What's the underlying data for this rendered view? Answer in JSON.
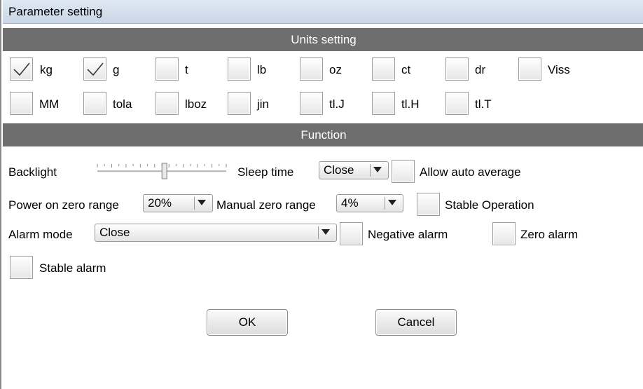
{
  "window": {
    "title": "Parameter setting"
  },
  "units_section": {
    "header": "Units setting",
    "units": [
      {
        "label": "kg",
        "checked": true
      },
      {
        "label": "g",
        "checked": true
      },
      {
        "label": "t",
        "checked": false
      },
      {
        "label": "lb",
        "checked": false
      },
      {
        "label": "oz",
        "checked": false
      },
      {
        "label": "ct",
        "checked": false
      },
      {
        "label": "dr",
        "checked": false
      },
      {
        "label": "Viss",
        "checked": false
      },
      {
        "label": "MM",
        "checked": false
      },
      {
        "label": "tola",
        "checked": false
      },
      {
        "label": "lboz",
        "checked": false
      },
      {
        "label": "jin",
        "checked": false
      },
      {
        "label": "tl.J",
        "checked": false
      },
      {
        "label": "tl.H",
        "checked": false
      },
      {
        "label": "tl.T",
        "checked": false
      }
    ]
  },
  "function_section": {
    "header": "Function",
    "backlight": {
      "label": "Backlight",
      "level": 0.52
    },
    "sleep_time": {
      "label": "Sleep time",
      "value": "Close"
    },
    "allow_auto_average": {
      "label": "Allow auto average",
      "checked": false
    },
    "power_on_zero_range": {
      "label": "Power on zero range",
      "value": "20%"
    },
    "manual_zero_range": {
      "label": "Manual zero range",
      "value": "4%"
    },
    "stable_operation": {
      "label": "Stable Operation",
      "checked": false
    },
    "alarm_mode": {
      "label": "Alarm mode",
      "value": "Close"
    },
    "negative_alarm": {
      "label": "Negative alarm",
      "checked": false
    },
    "zero_alarm": {
      "label": "Zero alarm",
      "checked": false
    },
    "stable_alarm": {
      "label": "Stable alarm",
      "checked": false
    }
  },
  "buttons": {
    "ok": "OK",
    "cancel": "Cancel"
  },
  "colors": {
    "section_header_bg": "#6e6e6e",
    "title_bar_bg": "#d4dfec"
  },
  "icons": {
    "checked": "check-mark-icon",
    "dropdown": "triangle-down-icon"
  }
}
